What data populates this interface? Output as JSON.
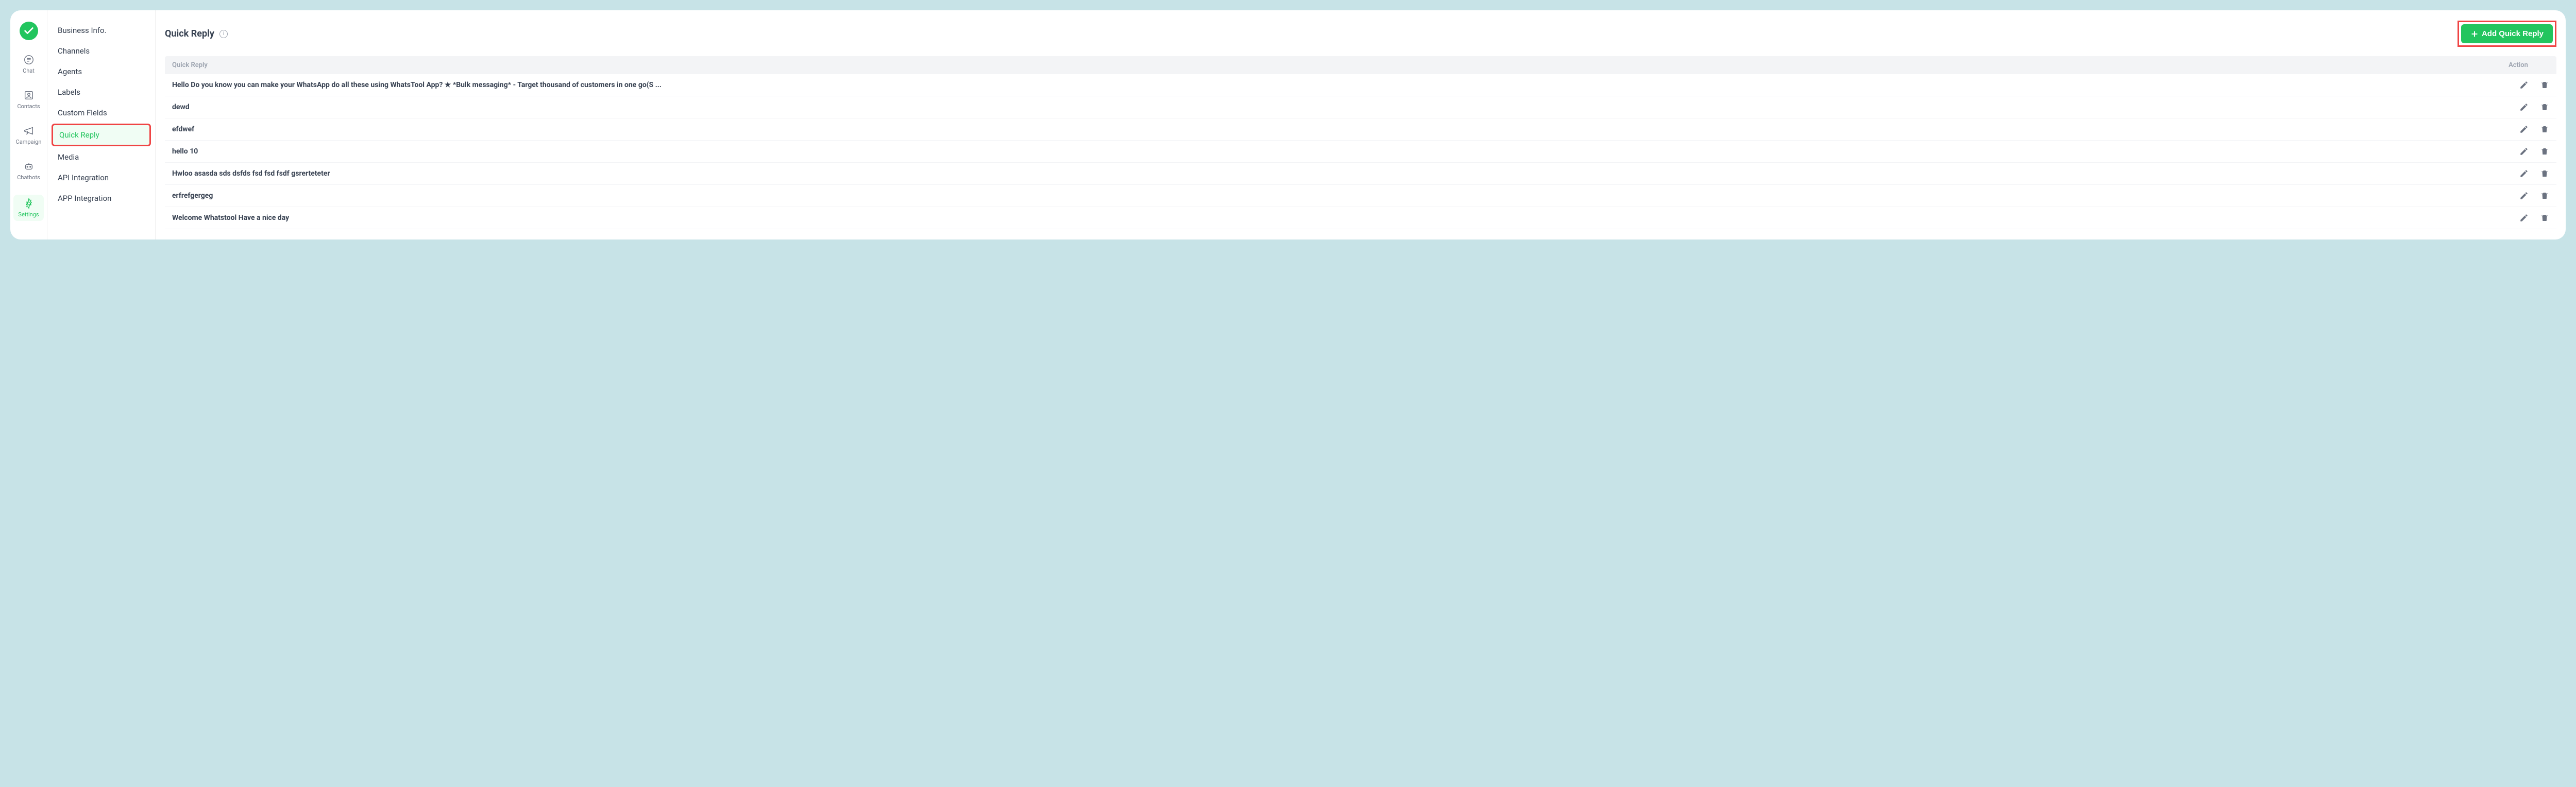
{
  "iconSidebar": {
    "items": [
      "Chat",
      "Contacts",
      "Campaign",
      "Chatbots",
      "Settings"
    ],
    "activeIndex": 4
  },
  "settingsNav": {
    "items": [
      "Business Info.",
      "Channels",
      "Agents",
      "Labels",
      "Custom Fields",
      "Quick Reply",
      "Media",
      "API Integration",
      "APP Integration"
    ],
    "activeIndex": 5
  },
  "page": {
    "title": "Quick Reply",
    "addButton": "Add Quick Reply"
  },
  "table": {
    "headers": {
      "text": "Quick Reply",
      "action": "Action"
    },
    "rows": [
      "Hello Do you know you can make your WhatsApp do all these using WhatsTool App? ★ *Bulk messaging* - Target thousand of customers in one go(S ...",
      "dewd",
      "efdwef",
      "hello 10",
      "Hwloo asasda sds dsfds fsd fsd fsdf gsrerteteter",
      "erfrefgergeg",
      "Welcome Whatstool Have a nice day"
    ]
  }
}
